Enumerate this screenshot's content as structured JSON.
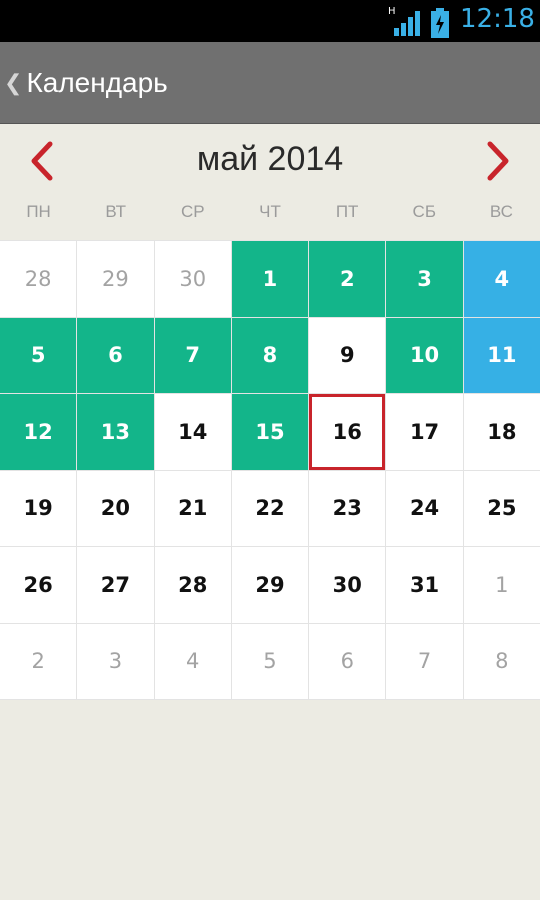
{
  "status": {
    "network": "H",
    "time": "12:18",
    "icons": [
      "signal-icon",
      "battery-charging-icon"
    ]
  },
  "header": {
    "back_icon": "chevron-left-icon",
    "title": "Календарь"
  },
  "calendar": {
    "month_label": "май 2014",
    "prev_icon": "chevron-left-icon",
    "next_icon": "chevron-right-icon",
    "weekdays": [
      "ПН",
      "ВТ",
      "СР",
      "ЧТ",
      "ПТ",
      "СБ",
      "ВС"
    ],
    "days": [
      {
        "label": "28",
        "type": "other"
      },
      {
        "label": "29",
        "type": "other"
      },
      {
        "label": "30",
        "type": "other"
      },
      {
        "label": "1",
        "type": "green"
      },
      {
        "label": "2",
        "type": "green"
      },
      {
        "label": "3",
        "type": "green"
      },
      {
        "label": "4",
        "type": "blue"
      },
      {
        "label": "5",
        "type": "green"
      },
      {
        "label": "6",
        "type": "green"
      },
      {
        "label": "7",
        "type": "green"
      },
      {
        "label": "8",
        "type": "green"
      },
      {
        "label": "9",
        "type": "normal"
      },
      {
        "label": "10",
        "type": "green"
      },
      {
        "label": "11",
        "type": "blue"
      },
      {
        "label": "12",
        "type": "green"
      },
      {
        "label": "13",
        "type": "green"
      },
      {
        "label": "14",
        "type": "normal"
      },
      {
        "label": "15",
        "type": "green"
      },
      {
        "label": "16",
        "type": "today"
      },
      {
        "label": "17",
        "type": "normal"
      },
      {
        "label": "18",
        "type": "normal"
      },
      {
        "label": "19",
        "type": "normal"
      },
      {
        "label": "20",
        "type": "normal"
      },
      {
        "label": "21",
        "type": "normal"
      },
      {
        "label": "22",
        "type": "normal"
      },
      {
        "label": "23",
        "type": "normal"
      },
      {
        "label": "24",
        "type": "normal"
      },
      {
        "label": "25",
        "type": "normal"
      },
      {
        "label": "26",
        "type": "normal"
      },
      {
        "label": "27",
        "type": "normal"
      },
      {
        "label": "28",
        "type": "normal"
      },
      {
        "label": "29",
        "type": "normal"
      },
      {
        "label": "30",
        "type": "normal"
      },
      {
        "label": "31",
        "type": "normal"
      },
      {
        "label": "1",
        "type": "other"
      },
      {
        "label": "2",
        "type": "other"
      },
      {
        "label": "3",
        "type": "other"
      },
      {
        "label": "4",
        "type": "other"
      },
      {
        "label": "5",
        "type": "other"
      },
      {
        "label": "6",
        "type": "other"
      },
      {
        "label": "7",
        "type": "other"
      },
      {
        "label": "8",
        "type": "other"
      }
    ]
  },
  "colors": {
    "marked_green": "#13b58a",
    "marked_blue": "#36b0e5",
    "today_border": "#c8242b",
    "action_bar": "#707070",
    "background": "#ecebe3"
  }
}
